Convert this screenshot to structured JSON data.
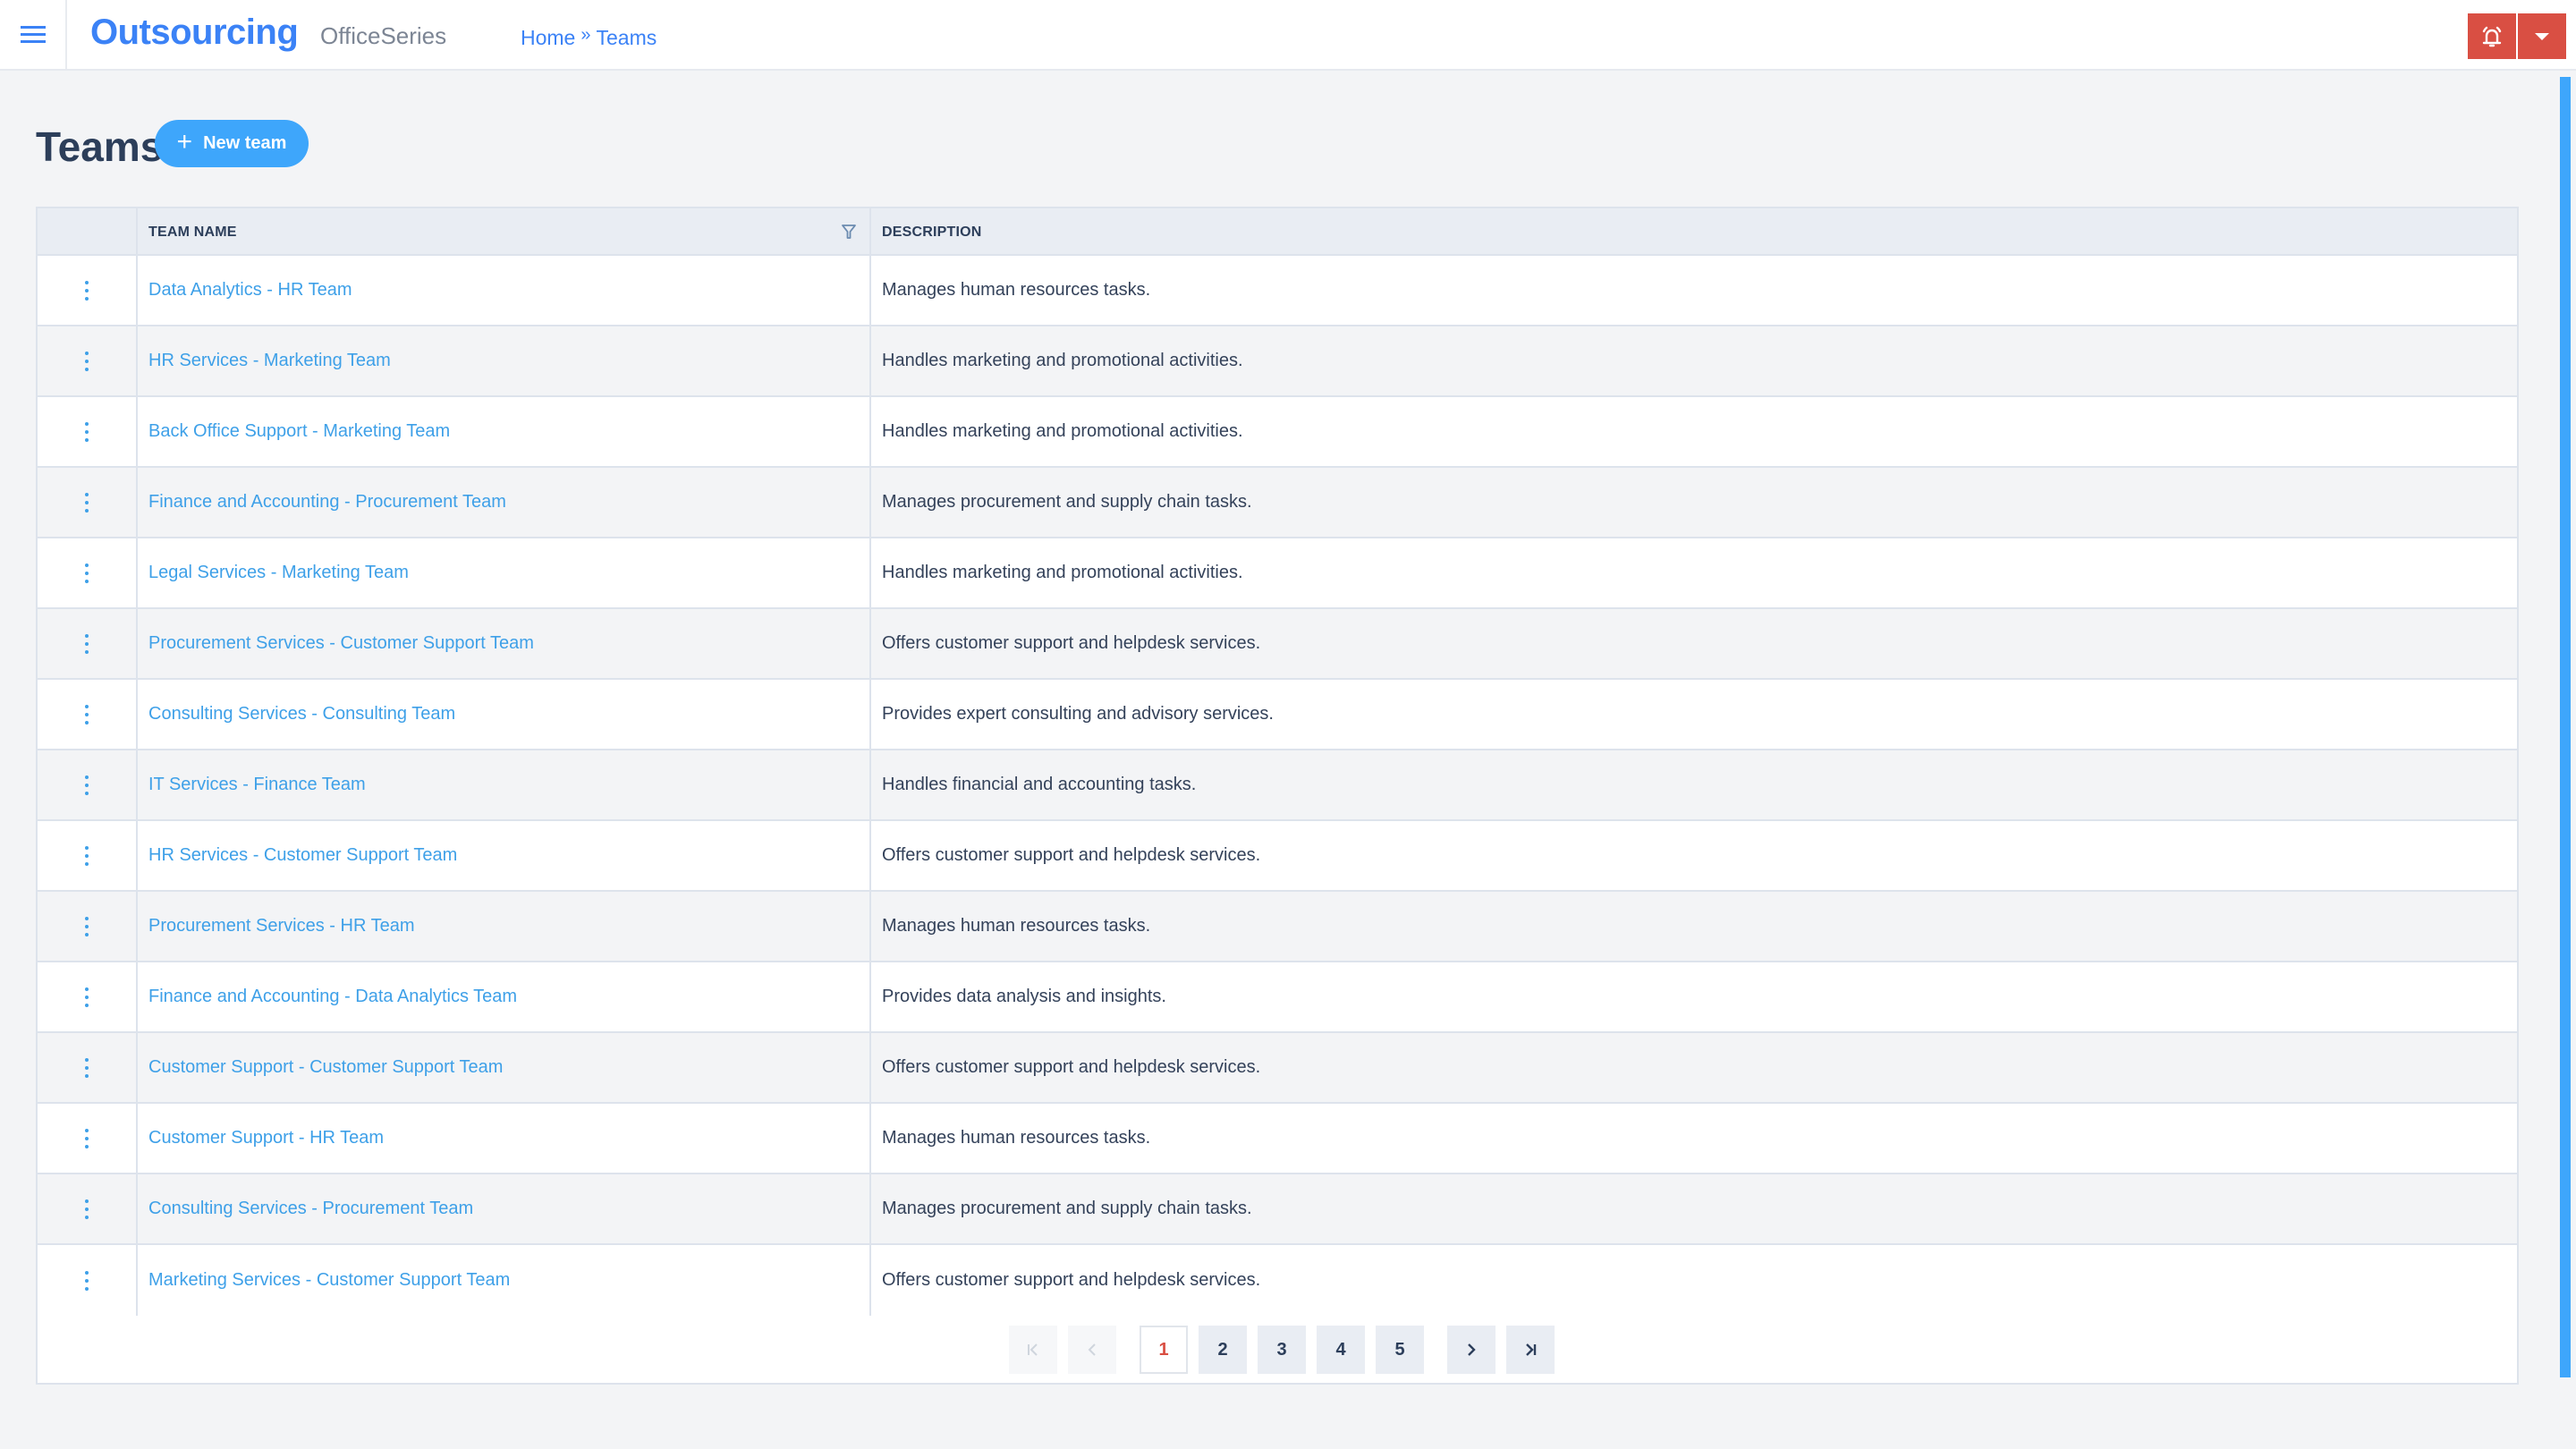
{
  "header": {
    "menu_icon": "hamburger-icon",
    "brand": "Outsourcing",
    "subbrand": "OfficeSeries",
    "breadcrumb": [
      {
        "label": "Home"
      },
      {
        "label": "Teams"
      }
    ],
    "breadcrumb_separator": "»",
    "alert_icon": "bell-alert-icon",
    "dropdown_icon": "caret-down-icon",
    "accent_color": "#3b82f6",
    "alert_color": "#d94f43"
  },
  "page": {
    "title": "Teams",
    "new_button_label": "New team",
    "new_button_icon": "plus-icon"
  },
  "table": {
    "columns": [
      {
        "label": ""
      },
      {
        "label": "TEAM NAME",
        "filter_icon": "filter-icon"
      },
      {
        "label": "DESCRIPTION"
      }
    ],
    "rows": [
      {
        "name": "Data Analytics - HR Team",
        "description": "Manages human resources tasks."
      },
      {
        "name": "HR Services - Marketing Team",
        "description": "Handles marketing and promotional activities."
      },
      {
        "name": "Back Office Support - Marketing Team",
        "description": "Handles marketing and promotional activities."
      },
      {
        "name": "Finance and Accounting - Procurement Team",
        "description": "Manages procurement and supply chain tasks."
      },
      {
        "name": "Legal Services - Marketing Team",
        "description": "Handles marketing and promotional activities."
      },
      {
        "name": "Procurement Services - Customer Support Team",
        "description": "Offers customer support and helpdesk services."
      },
      {
        "name": "Consulting Services - Consulting Team",
        "description": "Provides expert consulting and advisory services."
      },
      {
        "name": "IT Services - Finance Team",
        "description": "Handles financial and accounting tasks."
      },
      {
        "name": "HR Services - Customer Support Team",
        "description": "Offers customer support and helpdesk services."
      },
      {
        "name": "Procurement Services - HR Team",
        "description": "Manages human resources tasks."
      },
      {
        "name": "Finance and Accounting - Data Analytics Team",
        "description": "Provides data analysis and insights."
      },
      {
        "name": "Customer Support - Customer Support Team",
        "description": "Offers customer support and helpdesk services."
      },
      {
        "name": "Customer Support - HR Team",
        "description": "Manages human resources tasks."
      },
      {
        "name": "Consulting Services - Procurement Team",
        "description": "Manages procurement and supply chain tasks."
      },
      {
        "name": "Marketing Services - Customer Support Team",
        "description": "Offers customer support and helpdesk services."
      }
    ],
    "row_action_icon": "kebab-menu-icon"
  },
  "pagination": {
    "first_icon": "first-page-icon",
    "prev_icon": "prev-page-icon",
    "next_icon": "next-page-icon",
    "last_icon": "last-page-icon",
    "pages": [
      "1",
      "2",
      "3",
      "4",
      "5"
    ],
    "current_page": "1"
  }
}
